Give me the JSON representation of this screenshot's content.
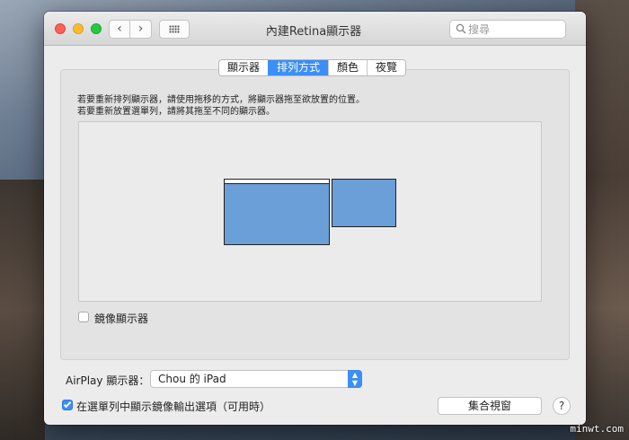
{
  "window": {
    "title": "內建Retina顯示器",
    "nav_back": "‹",
    "nav_forward": "›"
  },
  "search": {
    "placeholder": "搜尋"
  },
  "tabs": [
    {
      "label": "顯示器",
      "active": false
    },
    {
      "label": "排列方式",
      "active": true
    },
    {
      "label": "顏色",
      "active": false
    },
    {
      "label": "夜覽",
      "active": false
    }
  ],
  "description": {
    "line1": "若要重新排列顯示器，請使用拖移的方式，將顯示器拖至欲放置的位置。",
    "line2": "若要重新放置選單列，請將其拖至不同的顯示器。"
  },
  "displays": {
    "main_name": "內建Retina顯示器",
    "secondary_name": "Chou 的 iPad"
  },
  "mirror": {
    "label": "鏡像顯示器",
    "checked": false
  },
  "airplay": {
    "label": "AirPlay 顯示器：",
    "selected": "Chou 的 iPad"
  },
  "menubar_option": {
    "label": "在選單列中顯示鏡像輸出選項（可用時）",
    "checked": true
  },
  "buttons": {
    "gather": "集合視窗",
    "help": "?"
  },
  "watermark": "minwt.com",
  "colors": {
    "accent": "#3b8ff5",
    "display_fill": "#6a9fd8"
  },
  "icons": {
    "search": "magnifier-icon",
    "grid": "grid-icon"
  }
}
